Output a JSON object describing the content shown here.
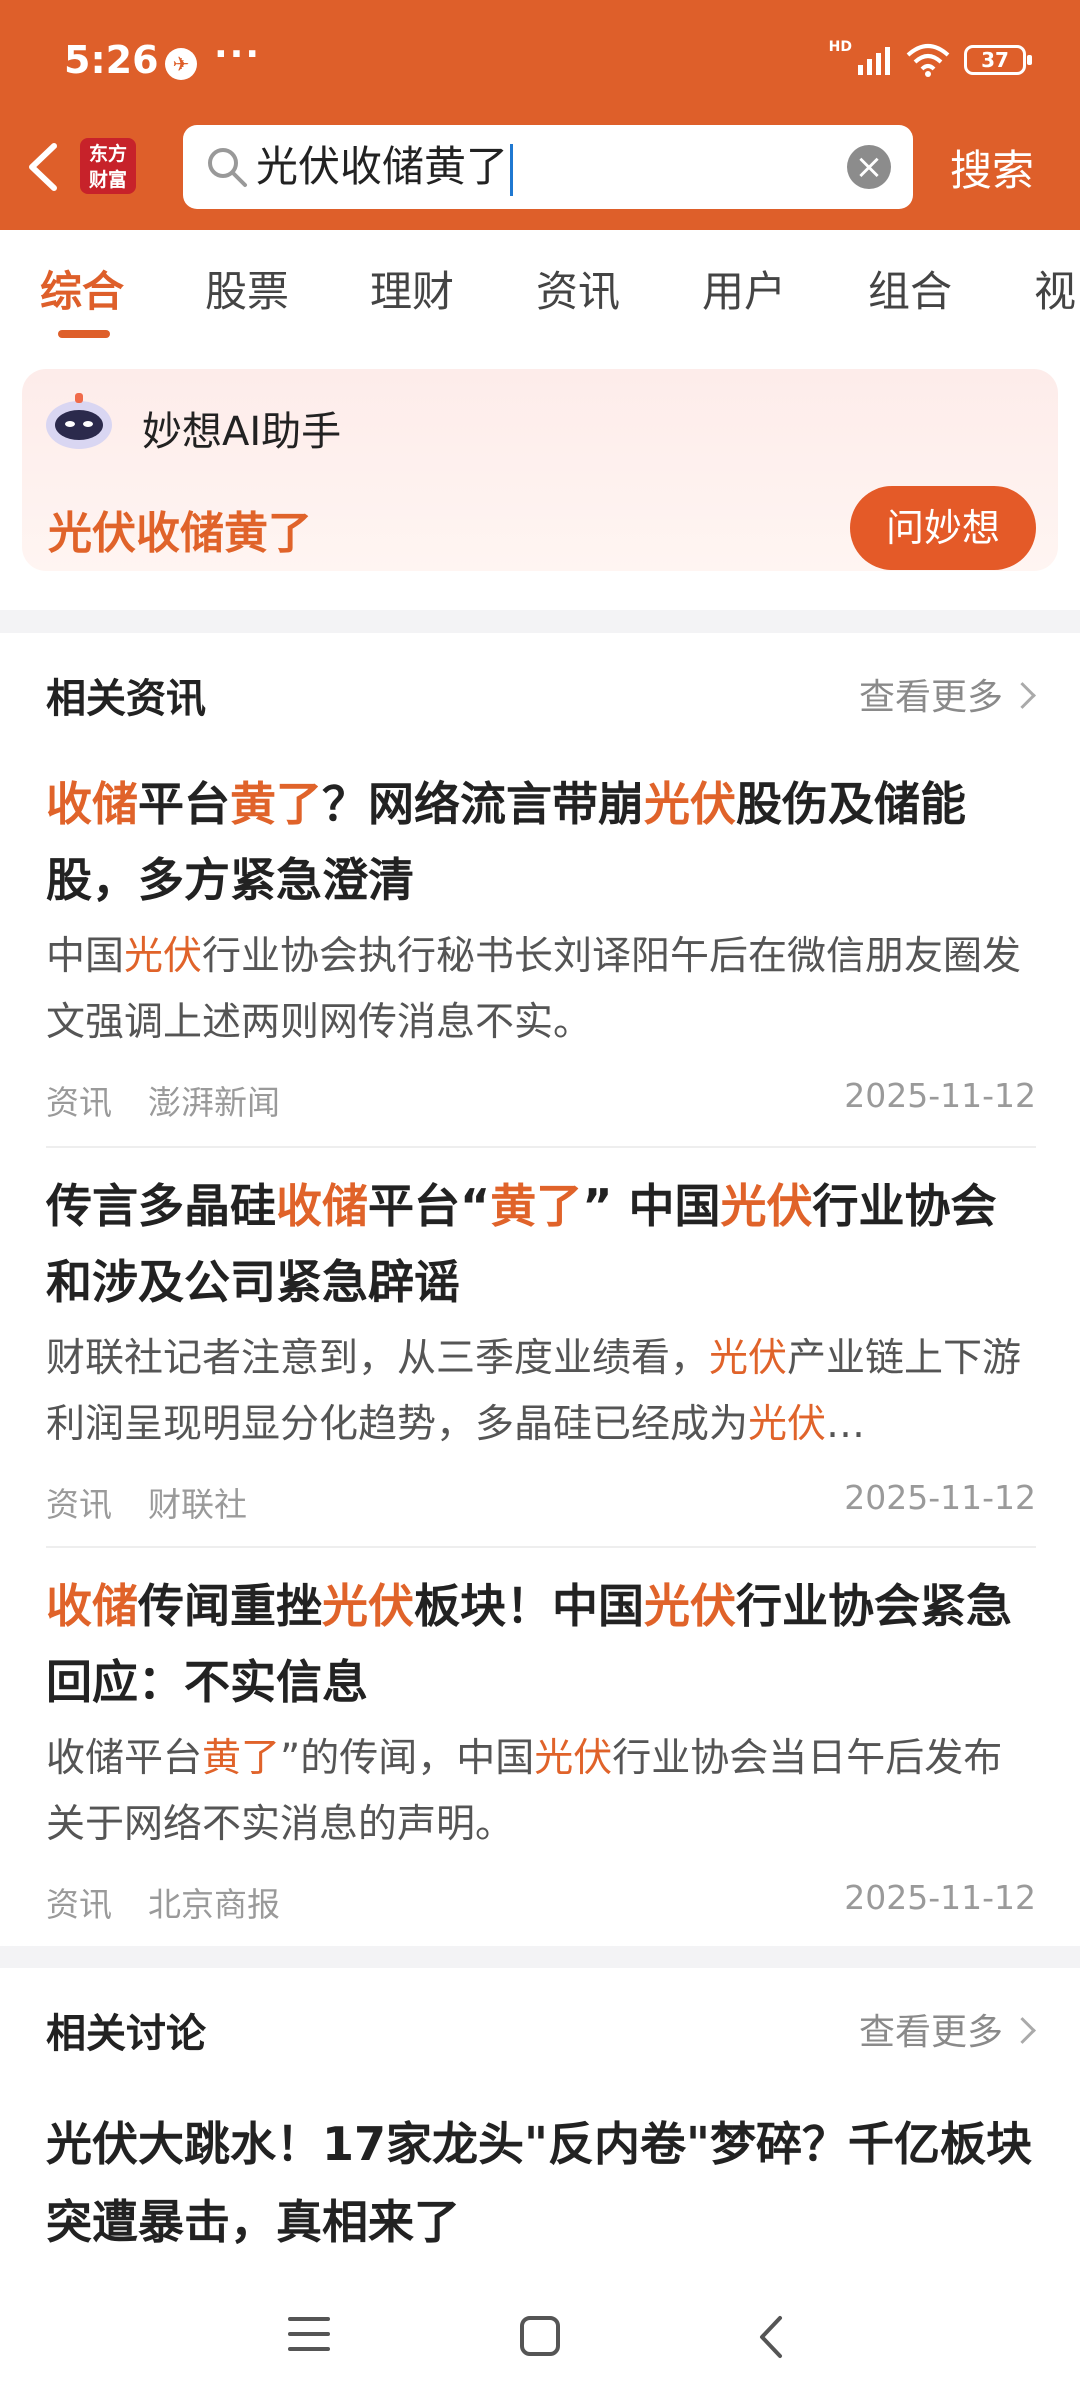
{
  "status_bar": {
    "time": "5:26",
    "dots": "···",
    "network": "HD",
    "battery": "37"
  },
  "header": {
    "logo_line1": "东方",
    "logo_line2": "财富",
    "search_value": "光伏收储黄了",
    "search_button": "搜索"
  },
  "tabs": [
    "综合",
    "股票",
    "理财",
    "资讯",
    "用户",
    "组合",
    "视"
  ],
  "ai_assistant": {
    "title": "妙想AI助手",
    "query": "光伏收储黄了",
    "button": "问妙想"
  },
  "news_section": {
    "title": "相关资讯",
    "more": "查看更多",
    "items": [
      {
        "title_parts": [
          [
            "收储",
            "hl"
          ],
          [
            "平台",
            ""
          ],
          [
            "黄了",
            "hl"
          ],
          [
            "？网络流言带崩",
            ""
          ],
          [
            "光伏",
            "hl"
          ],
          [
            "股伤及储能股，多方紧急澄清",
            ""
          ]
        ],
        "desc_parts": [
          [
            "中国",
            ""
          ],
          [
            "光伏",
            "hl"
          ],
          [
            "行业协会执行秘书长刘译阳午后在微信朋友圈发文强调上述两则网传消息不实。",
            ""
          ]
        ],
        "tag": "资讯",
        "source": "澎湃新闻",
        "date": "2025-11-12"
      },
      {
        "title_parts": [
          [
            "传言多晶硅",
            ""
          ],
          [
            "收储",
            "hl"
          ],
          [
            "平台“",
            ""
          ],
          [
            "黄了",
            "hl"
          ],
          [
            "” 中国",
            ""
          ],
          [
            "光伏",
            "hl"
          ],
          [
            "行业协会和涉及公司紧急辟谣",
            ""
          ]
        ],
        "desc_parts": [
          [
            "财联社记者注意到，从三季度业绩看，",
            ""
          ],
          [
            "光伏",
            "hl"
          ],
          [
            "产业链上下游利润呈现明显分化趋势，多晶硅已经成为",
            ""
          ],
          [
            "光伏",
            "hl"
          ],
          [
            "…",
            ""
          ]
        ],
        "tag": "资讯",
        "source": "财联社",
        "date": "2025-11-12"
      },
      {
        "title_parts": [
          [
            "收储",
            "hl"
          ],
          [
            "传闻重挫",
            ""
          ],
          [
            "光伏",
            "hl"
          ],
          [
            "板块！中国",
            ""
          ],
          [
            "光伏",
            "hl"
          ],
          [
            "行业协会紧急回应：不实信息",
            ""
          ]
        ],
        "desc_parts": [
          [
            "收储平台",
            ""
          ],
          [
            "黄了",
            "hl"
          ],
          [
            "”的传闻，中国",
            ""
          ],
          [
            "光伏",
            "hl"
          ],
          [
            "行业协会当日午后发布关于网络不实消息的声明。",
            ""
          ]
        ],
        "tag": "资讯",
        "source": "北京商报",
        "date": "2025-11-12"
      }
    ]
  },
  "discussion_section": {
    "title": "相关讨论",
    "more": "查看更多",
    "first_title": "光伏大跳水！17家龙头\"反内卷\"梦碎？千亿板块突遭暴击，真相来了"
  },
  "colors": {
    "brand": "#de5f2a",
    "highlight": "#e0632a"
  }
}
